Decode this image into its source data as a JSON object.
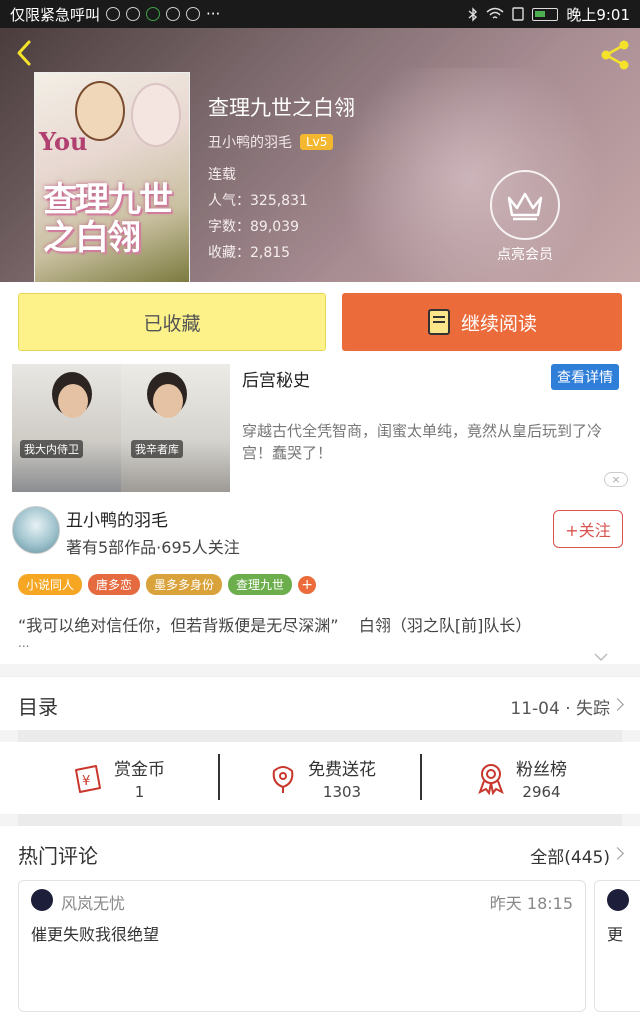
{
  "status_bar": {
    "left_text": "仅限紧急呼叫",
    "dots": "···",
    "time": "晚上9:01"
  },
  "book": {
    "title": "查理九世之白翎",
    "author": "丑小鸭的羽毛",
    "level": "Lv5",
    "status": "连载",
    "popularity": "人气：325,831",
    "words": "字数：89,039",
    "favorites": "收藏：2,815",
    "cover_title": "查理九世之白翎",
    "cover_en": "You"
  },
  "vip": {
    "label": "点亮会员"
  },
  "actions": {
    "favorited": "已收藏",
    "continue_reading": "继续阅读"
  },
  "ad": {
    "title": "后宫秘史",
    "detail_button": "查看详情",
    "description": "穿越古代全凭智商，闺蜜太单纯，竟然从皇后玩到了冷宫！蠢哭了！",
    "image_tag_left": "我大内侍卫",
    "image_tag_right": "我辛者库",
    "close": "×"
  },
  "author_card": {
    "name": "丑小鸭的羽毛",
    "stats": "著有5部作品·695人关注",
    "follow": "+关注",
    "tags": [
      {
        "label": "小说同人",
        "color": "#f5a623"
      },
      {
        "label": "唐多恋",
        "color": "#e66a3f"
      },
      {
        "label": "墨多多身份",
        "color": "#d9a23a"
      },
      {
        "label": "查理九世",
        "color": "#6dae4c"
      }
    ],
    "tag_more": "+",
    "quote": "“我可以绝对信任你，但若背叛便是无尽深渊”    白翎（羽之队[前]队长）",
    "ellipsis": "..."
  },
  "catalog": {
    "label": "目录",
    "latest": "11-04 · 失踪"
  },
  "stats": [
    {
      "name": "赏金币",
      "value": "1"
    },
    {
      "name": "免费送花",
      "value": "1303"
    },
    {
      "name": "粉丝榜",
      "value": "2964"
    }
  ],
  "comments": {
    "label": "热门评论",
    "all": "全部(445)",
    "items": [
      {
        "user": "风岚无忧",
        "time": "昨天 18:15",
        "text": "催更失败我很绝望"
      },
      {
        "user": "",
        "time": "",
        "text": "更"
      }
    ]
  },
  "colors": {
    "accent_orange": "#ec6b3a",
    "fav_yellow": "#fdf28a",
    "follow_red": "#d9534f",
    "ad_blue": "#2f7ed8"
  }
}
